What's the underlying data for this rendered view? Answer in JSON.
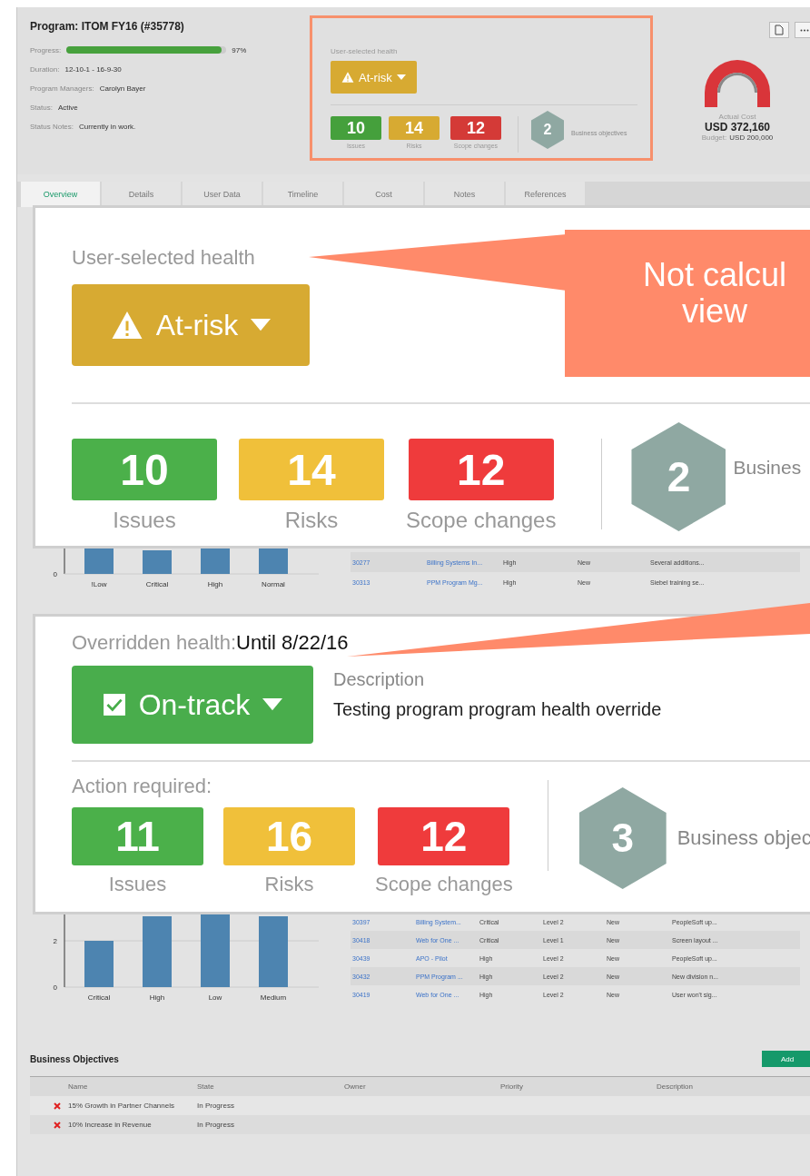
{
  "header": {
    "title": "Program: ITOM FY16 (#35778)",
    "progress": {
      "label": "Progress:",
      "level": 0.97,
      "reading": "97%"
    },
    "fields": [
      {
        "label": "Duration:",
        "value": "12-10-1 - 16-9-30"
      },
      {
        "label": "Program Managers:",
        "value": "Carolyn Bayer"
      },
      {
        "label": "Status:",
        "value": "Active"
      },
      {
        "label": "Status Notes:",
        "value": "Currently in work."
      }
    ],
    "health_panel": {
      "label": "User-selected health",
      "status": {
        "kind": "at-risk",
        "label": "At-risk"
      },
      "counts": [
        {
          "kind": "issues",
          "value": "10",
          "label": "Issues"
        },
        {
          "kind": "risks",
          "value": "14",
          "label": "Risks"
        },
        {
          "kind": "scope",
          "value": "12",
          "label": "Scope changes"
        }
      ],
      "objectives": {
        "value": "2",
        "label": "Business objectives"
      }
    },
    "cost": {
      "label": "Actual Cost",
      "value": "USD 372,160",
      "budget_label": "Budget:",
      "budget": "USD 200,000"
    }
  },
  "tabs": [
    {
      "label": "Overview",
      "selected": true
    },
    {
      "label": "Details",
      "selected": false
    },
    {
      "label": "User Data",
      "selected": false
    },
    {
      "label": "Timeline",
      "selected": false
    },
    {
      "label": "Cost",
      "selected": false
    },
    {
      "label": "Notes",
      "selected": false
    },
    {
      "label": "References",
      "selected": false
    }
  ],
  "callout_1": {
    "label": "User-selected health",
    "status": {
      "kind": "at-risk",
      "label": "At-risk"
    },
    "counts": [
      {
        "kind": "issues",
        "value": "10",
        "label": "Issues"
      },
      {
        "kind": "risks",
        "value": "14",
        "label": "Risks"
      },
      {
        "kind": "scope",
        "value": "12",
        "label": "Scope changes"
      }
    ],
    "objectives": {
      "value": "2",
      "label": "Busines"
    },
    "note": [
      "Not calcul",
      "view"
    ]
  },
  "chart_1": {
    "y_tick": "0",
    "categories": [
      "!Low",
      "Critical",
      "High",
      "Normal"
    ]
  },
  "table_1": {
    "rows": [
      [
        "30277",
        "Billing Systems In...",
        "High",
        "New",
        "Several additions..."
      ],
      [
        "30313",
        "PPM Program Mg...",
        "High",
        "New",
        "Siebel training se..."
      ]
    ]
  },
  "callout_2": {
    "label": "Overridden health:",
    "until": "Until 8/22/16",
    "status": {
      "kind": "on-track",
      "label": "On-track"
    },
    "description_label": "Description",
    "description": "Testing program program health override",
    "action_label": "Action required:",
    "counts": [
      {
        "kind": "issues",
        "value": "11",
        "label": "Issues"
      },
      {
        "kind": "risks",
        "value": "16",
        "label": "Risks"
      },
      {
        "kind": "scope",
        "value": "12",
        "label": "Scope changes"
      }
    ],
    "objectives": {
      "value": "3",
      "label": "Business objec"
    }
  },
  "chart_2": {
    "y_ticks": [
      "2",
      "0"
    ],
    "categories": [
      "Critical",
      "High",
      "Low",
      "Medium"
    ]
  },
  "table_2": {
    "rows": [
      [
        "30397",
        "Billing System...",
        "Critical",
        "Level 2",
        "New",
        "PeopleSoft up..."
      ],
      [
        "30418",
        "Web for One ...",
        "Critical",
        "Level 1",
        "New",
        "Screen layout ..."
      ],
      [
        "30439",
        "APO - Pilot",
        "High",
        "Level 2",
        "New",
        "PeopleSoft up..."
      ],
      [
        "30432",
        "PPM Program ...",
        "High",
        "Level 2",
        "New",
        "New division n..."
      ],
      [
        "30419",
        "Web for One ...",
        "High",
        "Level 2",
        "New",
        "User won't sig..."
      ]
    ]
  },
  "business_objectives": {
    "title": "Business Objectives",
    "add_button": "Add",
    "columns": [
      "Name",
      "State",
      "Owner",
      "Priority",
      "Description"
    ],
    "rows": [
      {
        "name": "15% Growth in Partner Channels",
        "state": "In Progress"
      },
      {
        "name": "10% Increase in Revenue",
        "state": "In Progress"
      }
    ]
  }
}
